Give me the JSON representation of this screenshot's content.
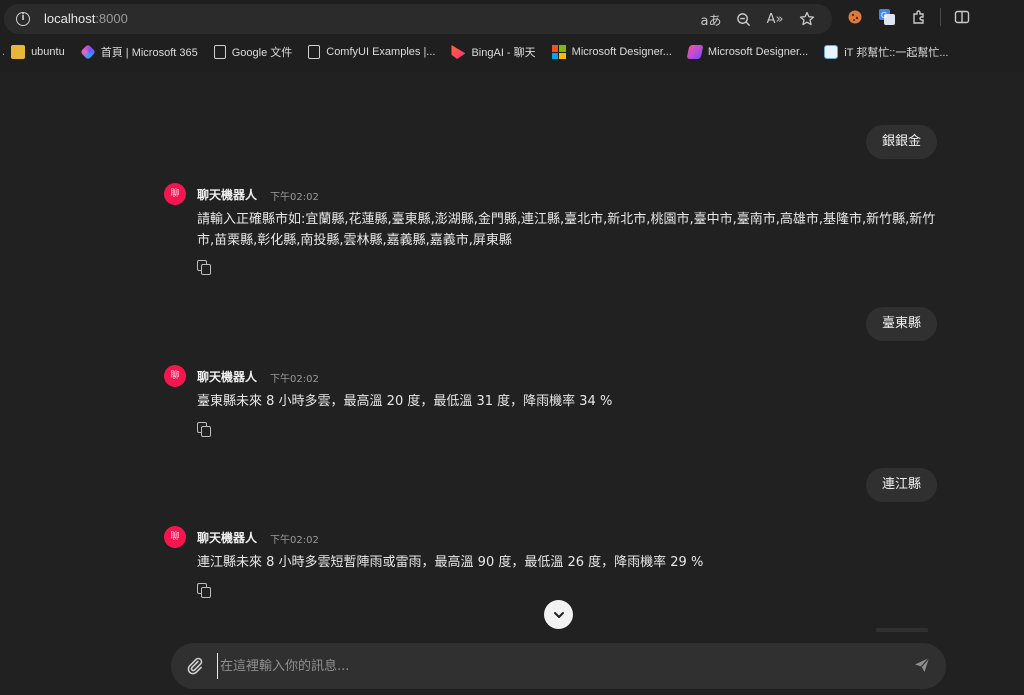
{
  "browser": {
    "url_host": "localhost",
    "url_port": ":8000",
    "tools": [
      {
        "icon": "read-aloud-translate-icon",
        "glyph": "aあ"
      },
      {
        "icon": "zoom-icon",
        "glyph": "⌕"
      },
      {
        "icon": "read-aloud-icon",
        "glyph": "A»"
      },
      {
        "icon": "favorite-star-icon",
        "glyph": "☆"
      }
    ]
  },
  "bookmarks": [
    {
      "label": "ubuntu",
      "icon": "folder-icon"
    },
    {
      "label": "首頁 | Microsoft 365",
      "icon": "microsoft365-icon"
    },
    {
      "label": "Google 文件",
      "icon": "document-icon"
    },
    {
      "label": "ComfyUI Examples |...",
      "icon": "document-icon"
    },
    {
      "label": "BingAI - 聊天",
      "icon": "bing-icon"
    },
    {
      "label": "Microsoft Designer...",
      "icon": "microsoft-icon"
    },
    {
      "label": "Microsoft Designer...",
      "icon": "designer-icon"
    },
    {
      "label": "iT 邦幫忙::一起幫忙...",
      "icon": "ithelp-icon"
    }
  ],
  "chat": {
    "messages": [
      {
        "role": "user",
        "text": "銀銀金"
      },
      {
        "role": "bot",
        "name": "聊天機器人",
        "time": "下午02:02",
        "avatar": "聊",
        "text": "請輸入正確縣市如:宜蘭縣,花蓮縣,臺東縣,澎湖縣,金門縣,連江縣,臺北市,新北市,桃園市,臺中市,臺南市,高雄市,基隆市,新竹縣,新竹市,苗栗縣,彰化縣,南投縣,雲林縣,嘉義縣,嘉義市,屏東縣"
      },
      {
        "role": "user",
        "text": "臺東縣"
      },
      {
        "role": "bot",
        "name": "聊天機器人",
        "time": "下午02:02",
        "avatar": "聊",
        "text": "臺東縣未來 8 小時多雲，最高溫 20 度，最低溫 31 度，降雨機率 34 %"
      },
      {
        "role": "user",
        "text": "連江縣"
      },
      {
        "role": "bot",
        "name": "聊天機器人",
        "time": "下午02:02",
        "avatar": "聊",
        "text": "連江縣未來 8 小時多雲短暫陣雨或雷雨，最高溫 90 度，最低溫 26 度，降雨機率 29 %"
      }
    ]
  },
  "composer": {
    "placeholder": "在這裡輸入你的訊息..."
  },
  "colors": {
    "background": "#212121",
    "bubble": "#303030",
    "bot_avatar": "#f4174f"
  }
}
